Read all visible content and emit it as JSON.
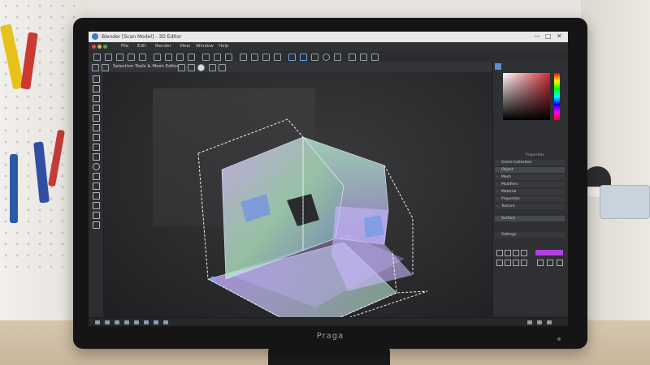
{
  "monitor": {
    "brand": "Praga"
  },
  "app": {
    "title": "Blender [Scan Model] - 3D Editor",
    "menu": [
      "File",
      "Edit",
      "Render",
      "View",
      "Window",
      "Help"
    ],
    "toolbar_label": "Selection Tools & Mesh Editor",
    "window_controls": [
      "—",
      "□",
      "✕"
    ]
  },
  "right_panel": {
    "properties_label": "Properties",
    "layers": [
      "Scene Collection",
      "Object",
      "Mesh",
      "Modifiers",
      "Material",
      "Properties",
      "Texture",
      "Surface"
    ],
    "section_label": "Settings"
  },
  "accent_colors": {
    "picker_red": "#d12a3a",
    "accent_pink": "#b43fe0",
    "mesh_purple": "#c9a7ff",
    "mesh_green": "#a8f0b8"
  },
  "icons": [
    "cursor-icon",
    "move-icon",
    "rotate-icon",
    "scale-icon",
    "brush-icon",
    "knife-icon",
    "loop-cut-icon",
    "grab-icon"
  ]
}
